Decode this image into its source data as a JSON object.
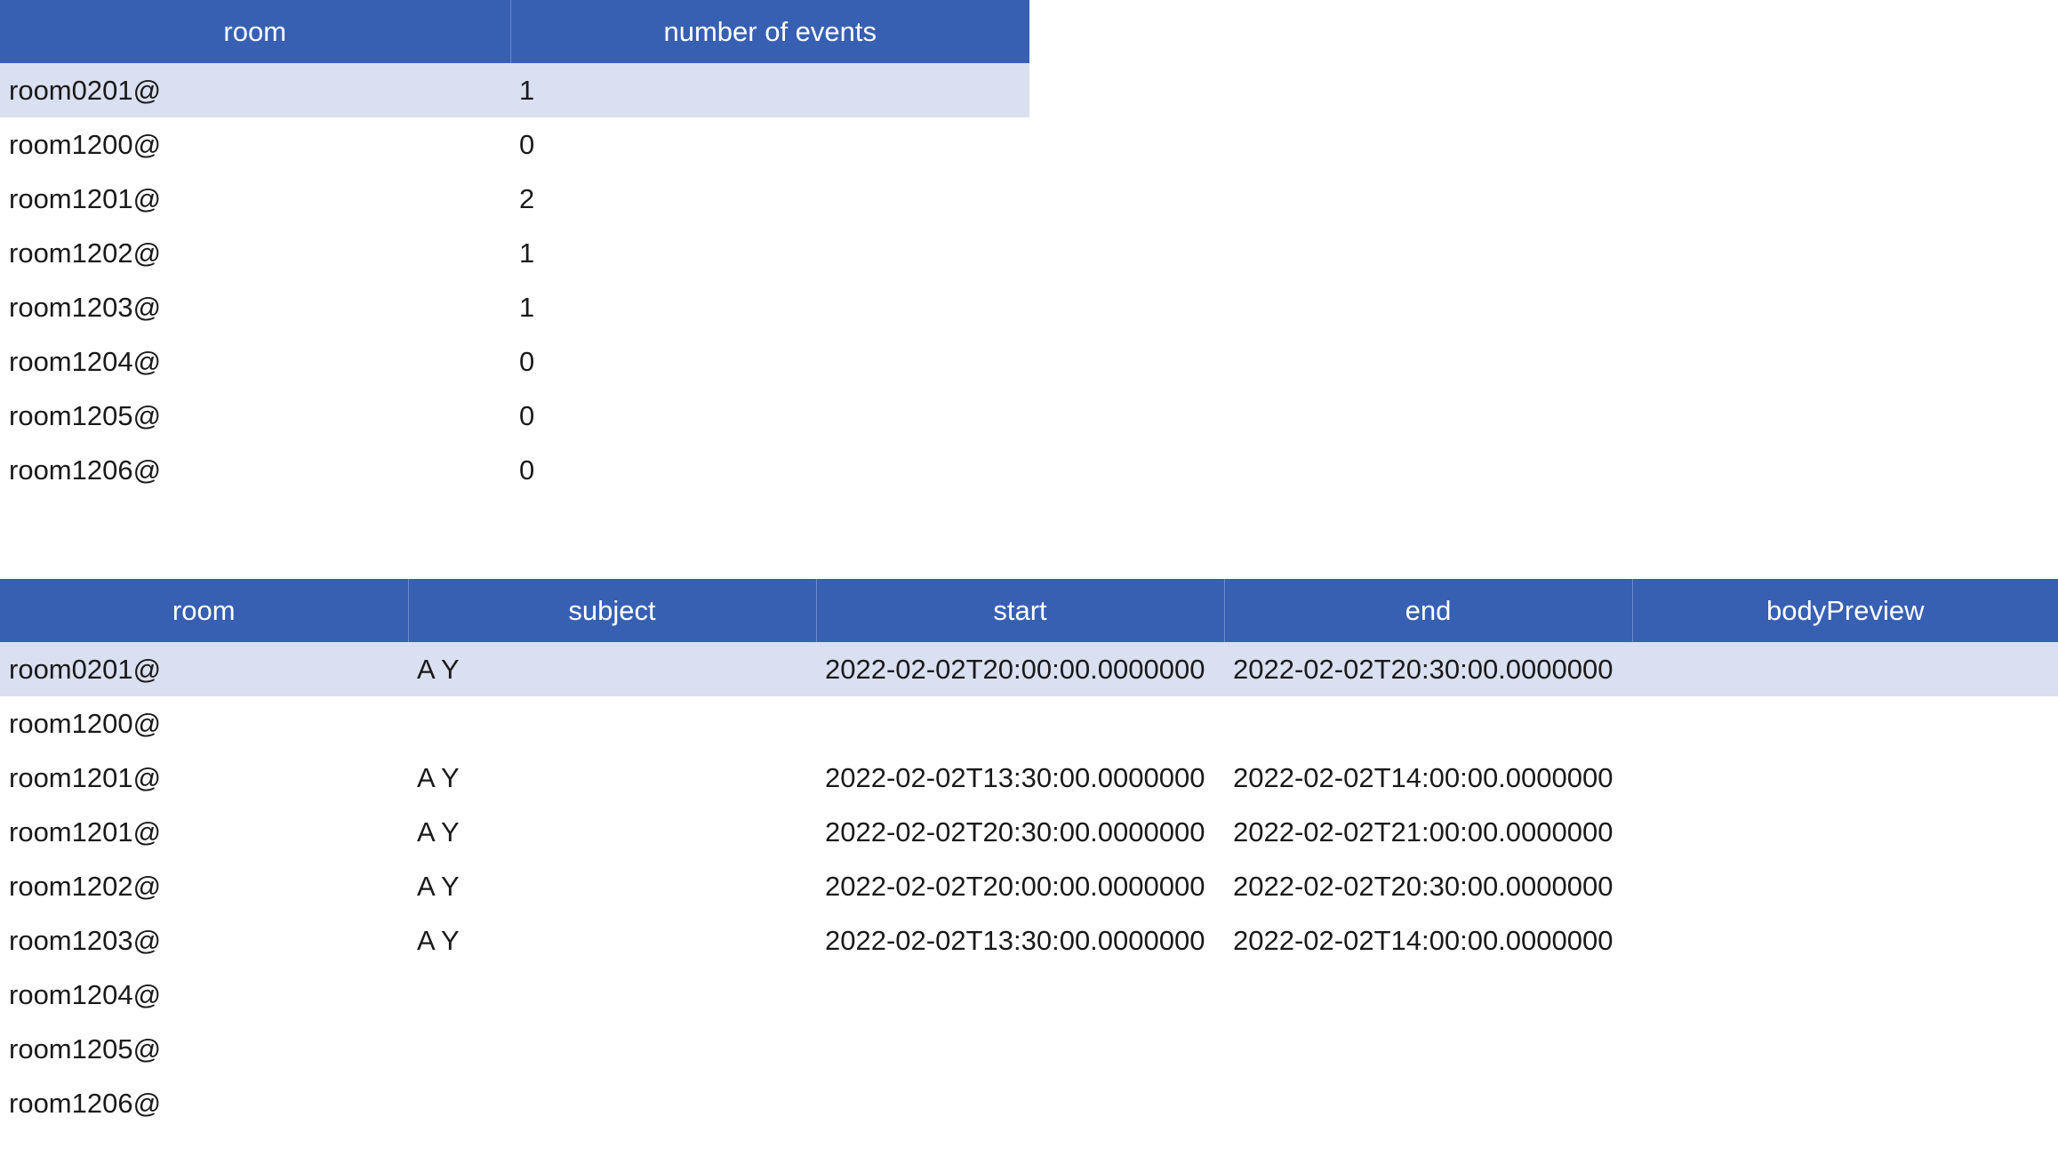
{
  "summary_table": {
    "headers": [
      "room",
      "number of events"
    ],
    "rows": [
      {
        "room": "room0201@",
        "count": "1"
      },
      {
        "room": "room1200@",
        "count": "0"
      },
      {
        "room": "room1201@",
        "count": "2"
      },
      {
        "room": "room1202@",
        "count": "1"
      },
      {
        "room": "room1203@",
        "count": "1"
      },
      {
        "room": "room1204@",
        "count": "0"
      },
      {
        "room": "room1205@",
        "count": "0"
      },
      {
        "room": "room1206@",
        "count": "0"
      }
    ],
    "selected_row": 0
  },
  "events_table": {
    "headers": [
      "room",
      "subject",
      "start",
      "end",
      "bodyPreview"
    ],
    "rows": [
      {
        "room": "room0201@",
        "subject": "A Y",
        "start": "2022-02-02T20:00:00.0000000",
        "end": "2022-02-02T20:30:00.0000000",
        "bodyPreview": ""
      },
      {
        "room": "room1200@",
        "subject": "",
        "start": "",
        "end": "",
        "bodyPreview": ""
      },
      {
        "room": "room1201@",
        "subject": "A Y",
        "start": "2022-02-02T13:30:00.0000000",
        "end": "2022-02-02T14:00:00.0000000",
        "bodyPreview": ""
      },
      {
        "room": "room1201@",
        "subject": "A Y",
        "start": "2022-02-02T20:30:00.0000000",
        "end": "2022-02-02T21:00:00.0000000",
        "bodyPreview": ""
      },
      {
        "room": "room1202@",
        "subject": "A Y",
        "start": "2022-02-02T20:00:00.0000000",
        "end": "2022-02-02T20:30:00.0000000",
        "bodyPreview": ""
      },
      {
        "room": "room1203@",
        "subject": "A Y",
        "start": "2022-02-02T13:30:00.0000000",
        "end": "2022-02-02T14:00:00.0000000",
        "bodyPreview": ""
      },
      {
        "room": "room1204@",
        "subject": "",
        "start": "",
        "end": "",
        "bodyPreview": ""
      },
      {
        "room": "room1205@",
        "subject": "",
        "start": "",
        "end": "",
        "bodyPreview": ""
      },
      {
        "room": "room1206@",
        "subject": "",
        "start": "",
        "end": "",
        "bodyPreview": ""
      }
    ],
    "selected_row": 0
  },
  "colors": {
    "header_bg": "#3760b3",
    "header_text": "#ffffff",
    "selected_row_bg": "#d9e0f1"
  }
}
